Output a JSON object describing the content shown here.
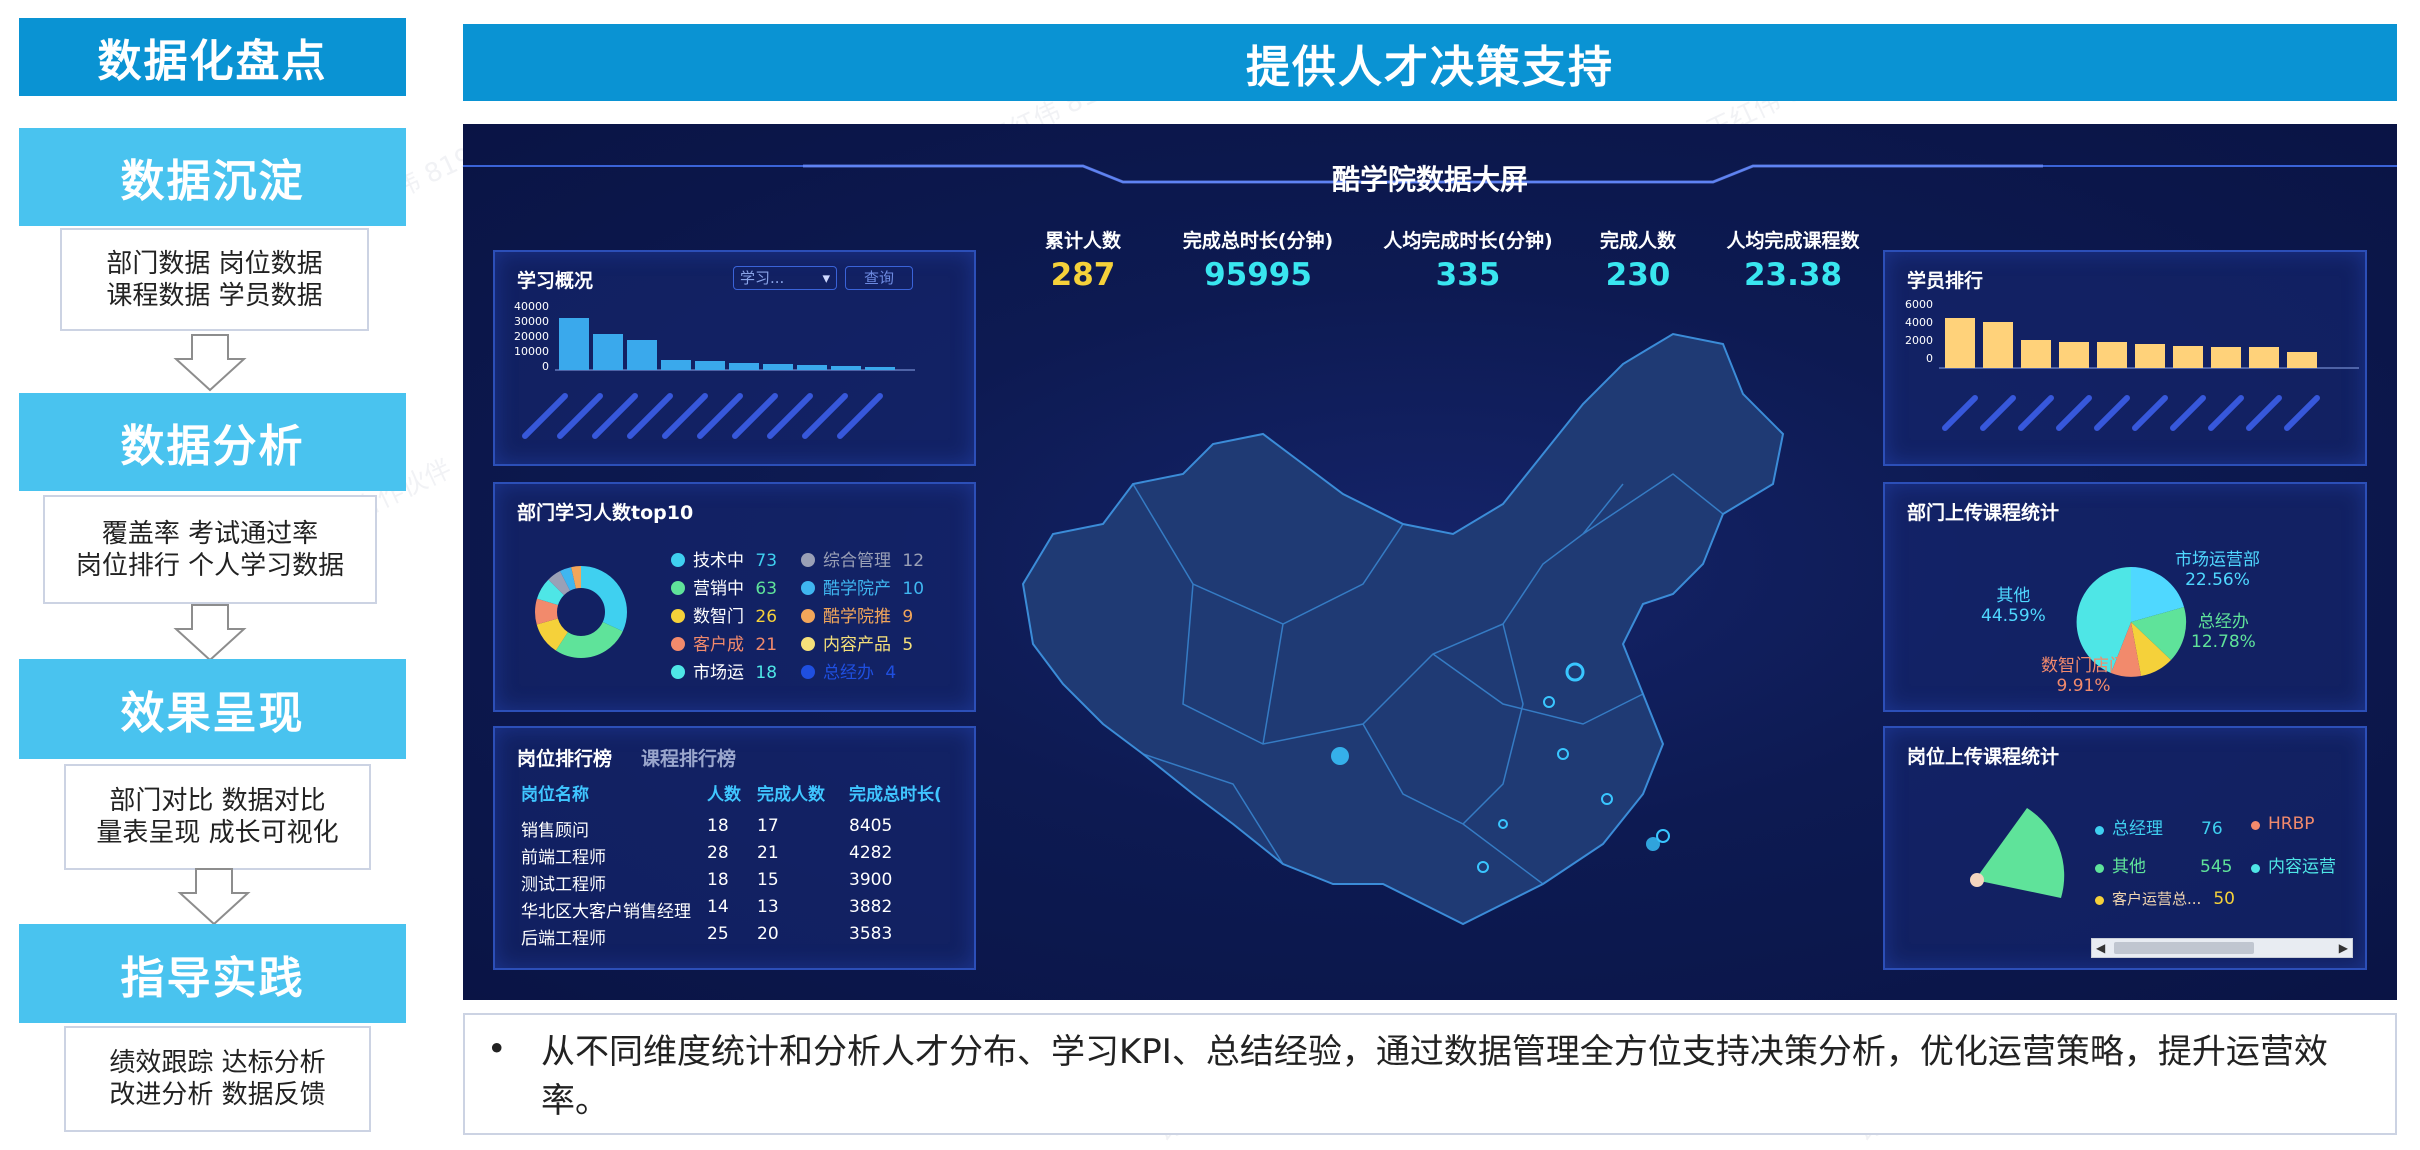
{
  "colors": {
    "left_header": "#0a93d3",
    "step_header": "#49c3ef",
    "top_banner": "#0a93d3",
    "board_bg": "#0d1a52",
    "accent_cyan": "#39e6f0",
    "accent_yellow": "#f5d13a",
    "bar_blue": "#3aa9ec",
    "bar_yellow": "#ffd27a"
  },
  "left": {
    "title": "数据化盘点",
    "steps": [
      {
        "title": "数据沉淀",
        "line1": "部门数据  岗位数据",
        "line2": "课程数据  学员数据"
      },
      {
        "title": "数据分析",
        "line1": "覆盖率  考试通过率",
        "line2": "岗位排行  个人学习数据"
      },
      {
        "title": "效果呈现",
        "line1": "部门对比  数据对比",
        "line2": "量表呈现  成长可视化"
      },
      {
        "title": "指导实践",
        "line1": "绩效跟踪  达标分析",
        "line2": "改进分析  数据反馈"
      }
    ]
  },
  "banner": {
    "title": "提供人才决策支持"
  },
  "dashboard": {
    "title": "酷学院数据大屏",
    "kpis": [
      {
        "label": "累计人数",
        "value": "287",
        "color": "#f5d13a"
      },
      {
        "label": "完成总时长(分钟)",
        "value": "95995",
        "color": "#39e6f0"
      },
      {
        "label": "人均完成时长(分钟)",
        "value": "335",
        "color": "#39e6f0"
      },
      {
        "label": "完成人数",
        "value": "230",
        "color": "#39e6f0"
      },
      {
        "label": "人均完成课程数",
        "value": "23.38",
        "color": "#39e6f0"
      }
    ],
    "study_overview": {
      "title": "学习概况",
      "select_value": "学习...",
      "query_label": "查询",
      "y_ticks": [
        "40000",
        "30000",
        "20000",
        "10000",
        "0"
      ]
    },
    "dept_top10": {
      "title": "部门学习人数top10",
      "items": [
        {
          "name": "技术中",
          "value": "73",
          "color": "#3fd0f0"
        },
        {
          "name": "营销中",
          "value": "63",
          "color": "#5fe39a"
        },
        {
          "name": "数智门",
          "value": "26",
          "color": "#f5d13a"
        },
        {
          "name": "客户成",
          "value": "21",
          "color": "#f28a6c"
        },
        {
          "name": "市场运",
          "value": "18",
          "color": "#4ee6e6"
        },
        {
          "name": "综合管理",
          "value": "12",
          "color": "#9aa0b6"
        },
        {
          "name": "酷学院产",
          "value": "10",
          "color": "#3fb6f0"
        },
        {
          "name": "酷学院推",
          "value": "9",
          "color": "#f2a65a"
        },
        {
          "name": "内容产品",
          "value": "5",
          "color": "#f5e07a"
        },
        {
          "name": "总经办",
          "value": "4",
          "color": "#1f4fe0"
        }
      ]
    },
    "rank_table": {
      "tab_active": "岗位排行榜",
      "tab_inactive": "课程排行榜",
      "columns": [
        "岗位名称",
        "人数",
        "完成人数",
        "完成总时长("
      ],
      "rows": [
        [
          "销售顾问",
          "18",
          "17",
          "8405"
        ],
        [
          "前端工程师",
          "28",
          "21",
          "4282"
        ],
        [
          "测试工程师",
          "18",
          "15",
          "3900"
        ],
        [
          "华北区大客户销售经理",
          "14",
          "13",
          "3882"
        ],
        [
          "后端工程师",
          "25",
          "20",
          "3583"
        ]
      ]
    },
    "student_rank": {
      "title": "学员排行",
      "y_ticks": [
        "6000",
        "4000",
        "2000",
        "0"
      ]
    },
    "dept_course": {
      "title": "部门上传课程统计",
      "labels": [
        {
          "name": "市场运营部",
          "pct": "22.56%",
          "color": "#4fd8ff"
        },
        {
          "name": "其他",
          "pct": "44.59%",
          "color": "#4fd8ff"
        },
        {
          "name": "总经办",
          "pct": "12.78%",
          "color": "#5fe39a"
        },
        {
          "name": "数智门店门",
          "pct": "9.91%",
          "color": "#f28a6c"
        }
      ]
    },
    "post_course": {
      "title": "岗位上传课程统计",
      "items": [
        {
          "name": "总经理",
          "value": "76",
          "color": "#3fd0f0"
        },
        {
          "name": "HRBP",
          "value": "",
          "color": "#f28a6c"
        },
        {
          "name": "其他",
          "value": "545",
          "color": "#5fe39a"
        },
        {
          "name": "内容运营",
          "value": "",
          "color": "#4ee6e6"
        },
        {
          "name": "客户运营总...",
          "value": "50",
          "color": "#f5d13a"
        }
      ]
    }
  },
  "note": {
    "bullet": "•",
    "text": "从不同维度统计和分析人才分布、学习KPI、总结经验，通过数据管理全方位支持决策分析，优化运营策略，提升运营效率。"
  }
}
